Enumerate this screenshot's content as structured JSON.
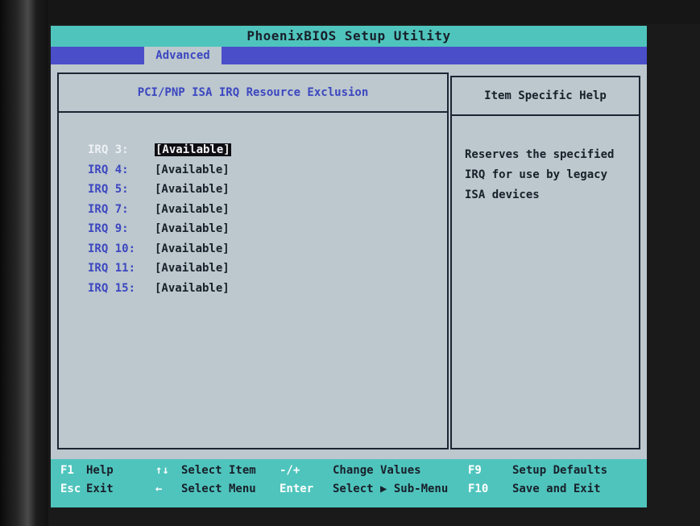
{
  "title": "PhoenixBIOS Setup Utility",
  "menu": {
    "active_tab": "Advanced"
  },
  "main_panel": {
    "heading": "PCI/PNP ISA IRQ Resource Exclusion",
    "items": [
      {
        "label": "IRQ 3:",
        "value": "[Available]",
        "selected": true
      },
      {
        "label": "IRQ 4:",
        "value": "[Available]"
      },
      {
        "label": "IRQ 5:",
        "value": "[Available]"
      },
      {
        "label": "IRQ 7:",
        "value": "[Available]"
      },
      {
        "label": "IRQ 9:",
        "value": "[Available]"
      },
      {
        "label": "IRQ 10:",
        "value": "[Available]"
      },
      {
        "label": "IRQ 11:",
        "value": "[Available]"
      },
      {
        "label": "IRQ 15:",
        "value": "[Available]"
      }
    ]
  },
  "help_panel": {
    "heading": "Item Specific Help",
    "lines": [
      "Reserves the specified",
      "IRQ for use by legacy",
      "ISA devices"
    ]
  },
  "footer": {
    "row1": [
      {
        "key": "F1",
        "desc": "Help"
      },
      {
        "key": "↑↓",
        "desc": "Select Item"
      },
      {
        "key": "-/+",
        "desc": "Change Values"
      },
      {
        "key": "F9",
        "desc": "Setup Defaults"
      }
    ],
    "row2": [
      {
        "key": "Esc",
        "desc": "Exit"
      },
      {
        "key": "←",
        "desc": "Select Menu"
      },
      {
        "key": "Enter",
        "desc": "Select ▶ Sub-Menu"
      },
      {
        "key": "F10",
        "desc": "Save and Exit"
      }
    ]
  },
  "colors": {
    "title_bar": "#4fc4bd",
    "menu_bar": "#4b4ec9",
    "screen_background": "#bcc7ce",
    "label_blue": "#3c47c0",
    "text_dark": "#18202a",
    "selection_background": "#0d0d12"
  }
}
